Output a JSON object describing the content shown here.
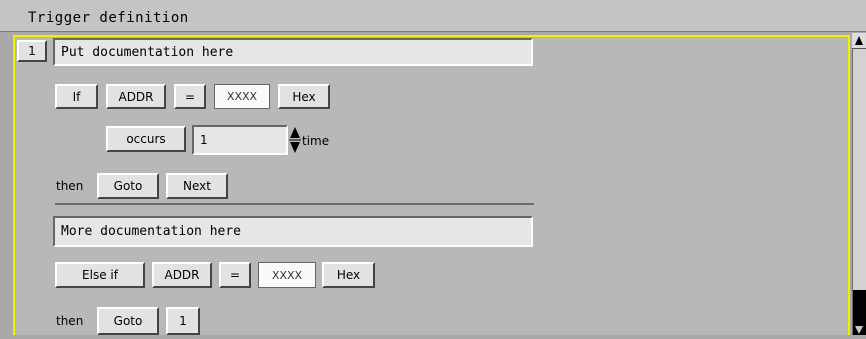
{
  "window": {
    "title": "Trigger definition"
  },
  "state1": {
    "number": "1",
    "doc": "Put documentation here",
    "if_label": "If",
    "addr_label": "ADDR",
    "op_label": "=",
    "value": "XXXX",
    "base_label": "Hex",
    "occurs_label": "occurs",
    "occurs_value": "1",
    "time_label": "time",
    "then_label": "then",
    "goto_label": "Goto",
    "target_label": "Next"
  },
  "branch2": {
    "doc": "More documentation here",
    "elseif_label": "Else if",
    "addr_label": "ADDR",
    "op_label": "=",
    "value": "XXXX",
    "base_label": "Hex",
    "then_label": "then",
    "goto_label": "Goto",
    "target_label": "1"
  },
  "colors": {
    "focus_border": "#f0f000",
    "background": "#b8b8b8"
  }
}
